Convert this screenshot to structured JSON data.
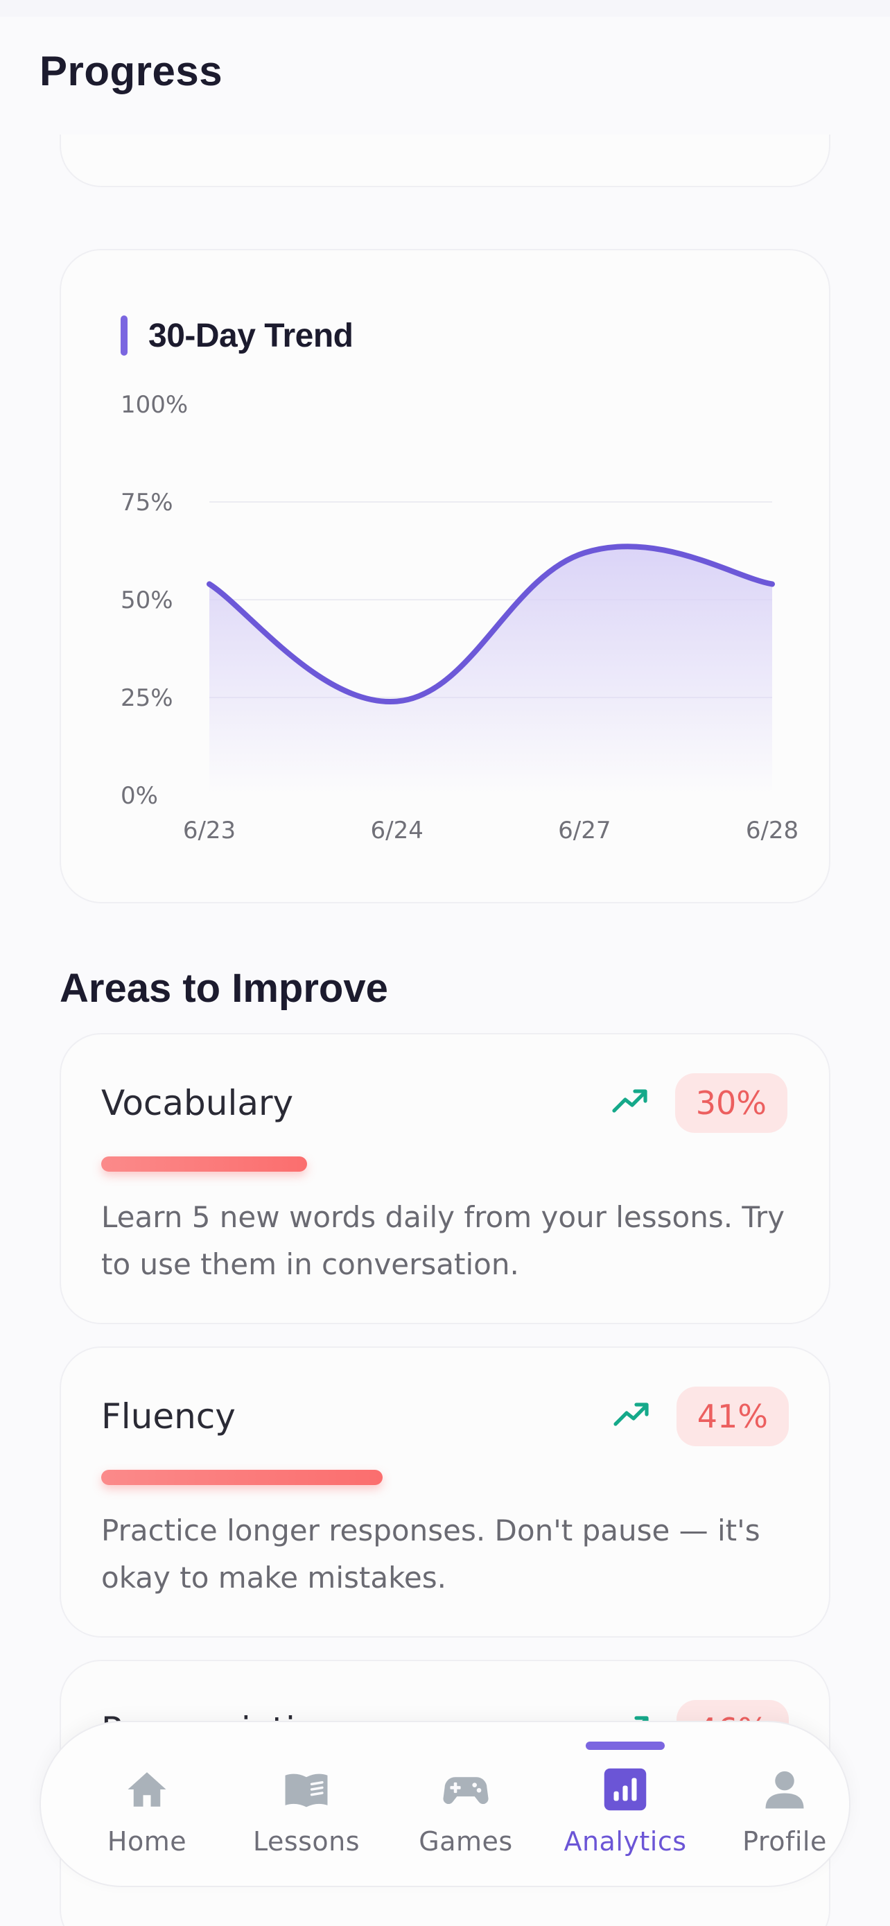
{
  "header": {
    "title": "Progress"
  },
  "trend_card": {
    "title": "30-Day Trend"
  },
  "chart_data": {
    "type": "area",
    "x": [
      "6/23",
      "6/24",
      "6/27",
      "6/28"
    ],
    "values": [
      54,
      24,
      62,
      54
    ],
    "ylim": [
      0,
      100
    ],
    "y_ticks": [
      "0%",
      "25%",
      "50%",
      "75%",
      "100%"
    ],
    "y_tick_values": [
      0,
      25,
      50,
      75,
      100
    ],
    "grid": true,
    "colors": {
      "line": "#6c58d8",
      "fill": "#d9d2f7"
    }
  },
  "areas": {
    "title": "Areas to Improve",
    "items": [
      {
        "name": "Vocabulary",
        "percent": "30%",
        "value": 30,
        "desc": "Learn 5 new words daily from your lessons. Try to use them in conversation."
      },
      {
        "name": "Fluency",
        "percent": "41%",
        "value": 41,
        "desc": "Practice longer responses. Don't pause — it's okay to make mistakes."
      },
      {
        "name": "Pronunciation",
        "percent": "46%",
        "value": 46,
        "desc": ""
      }
    ],
    "colors": {
      "trend_icon": "#15a98a",
      "badge_bg": "#fde6e6",
      "badge_text": "#ec5f5f"
    }
  },
  "nav": {
    "items": [
      {
        "label": "Home",
        "icon": "home-icon"
      },
      {
        "label": "Lessons",
        "icon": "book-icon"
      },
      {
        "label": "Games",
        "icon": "gamepad-icon"
      },
      {
        "label": "Analytics",
        "icon": "analytics-icon",
        "active": true
      },
      {
        "label": "Profile",
        "icon": "profile-icon"
      }
    ],
    "colors": {
      "active": "#6b55d6",
      "inactive_icon": "#aab2ba"
    }
  }
}
